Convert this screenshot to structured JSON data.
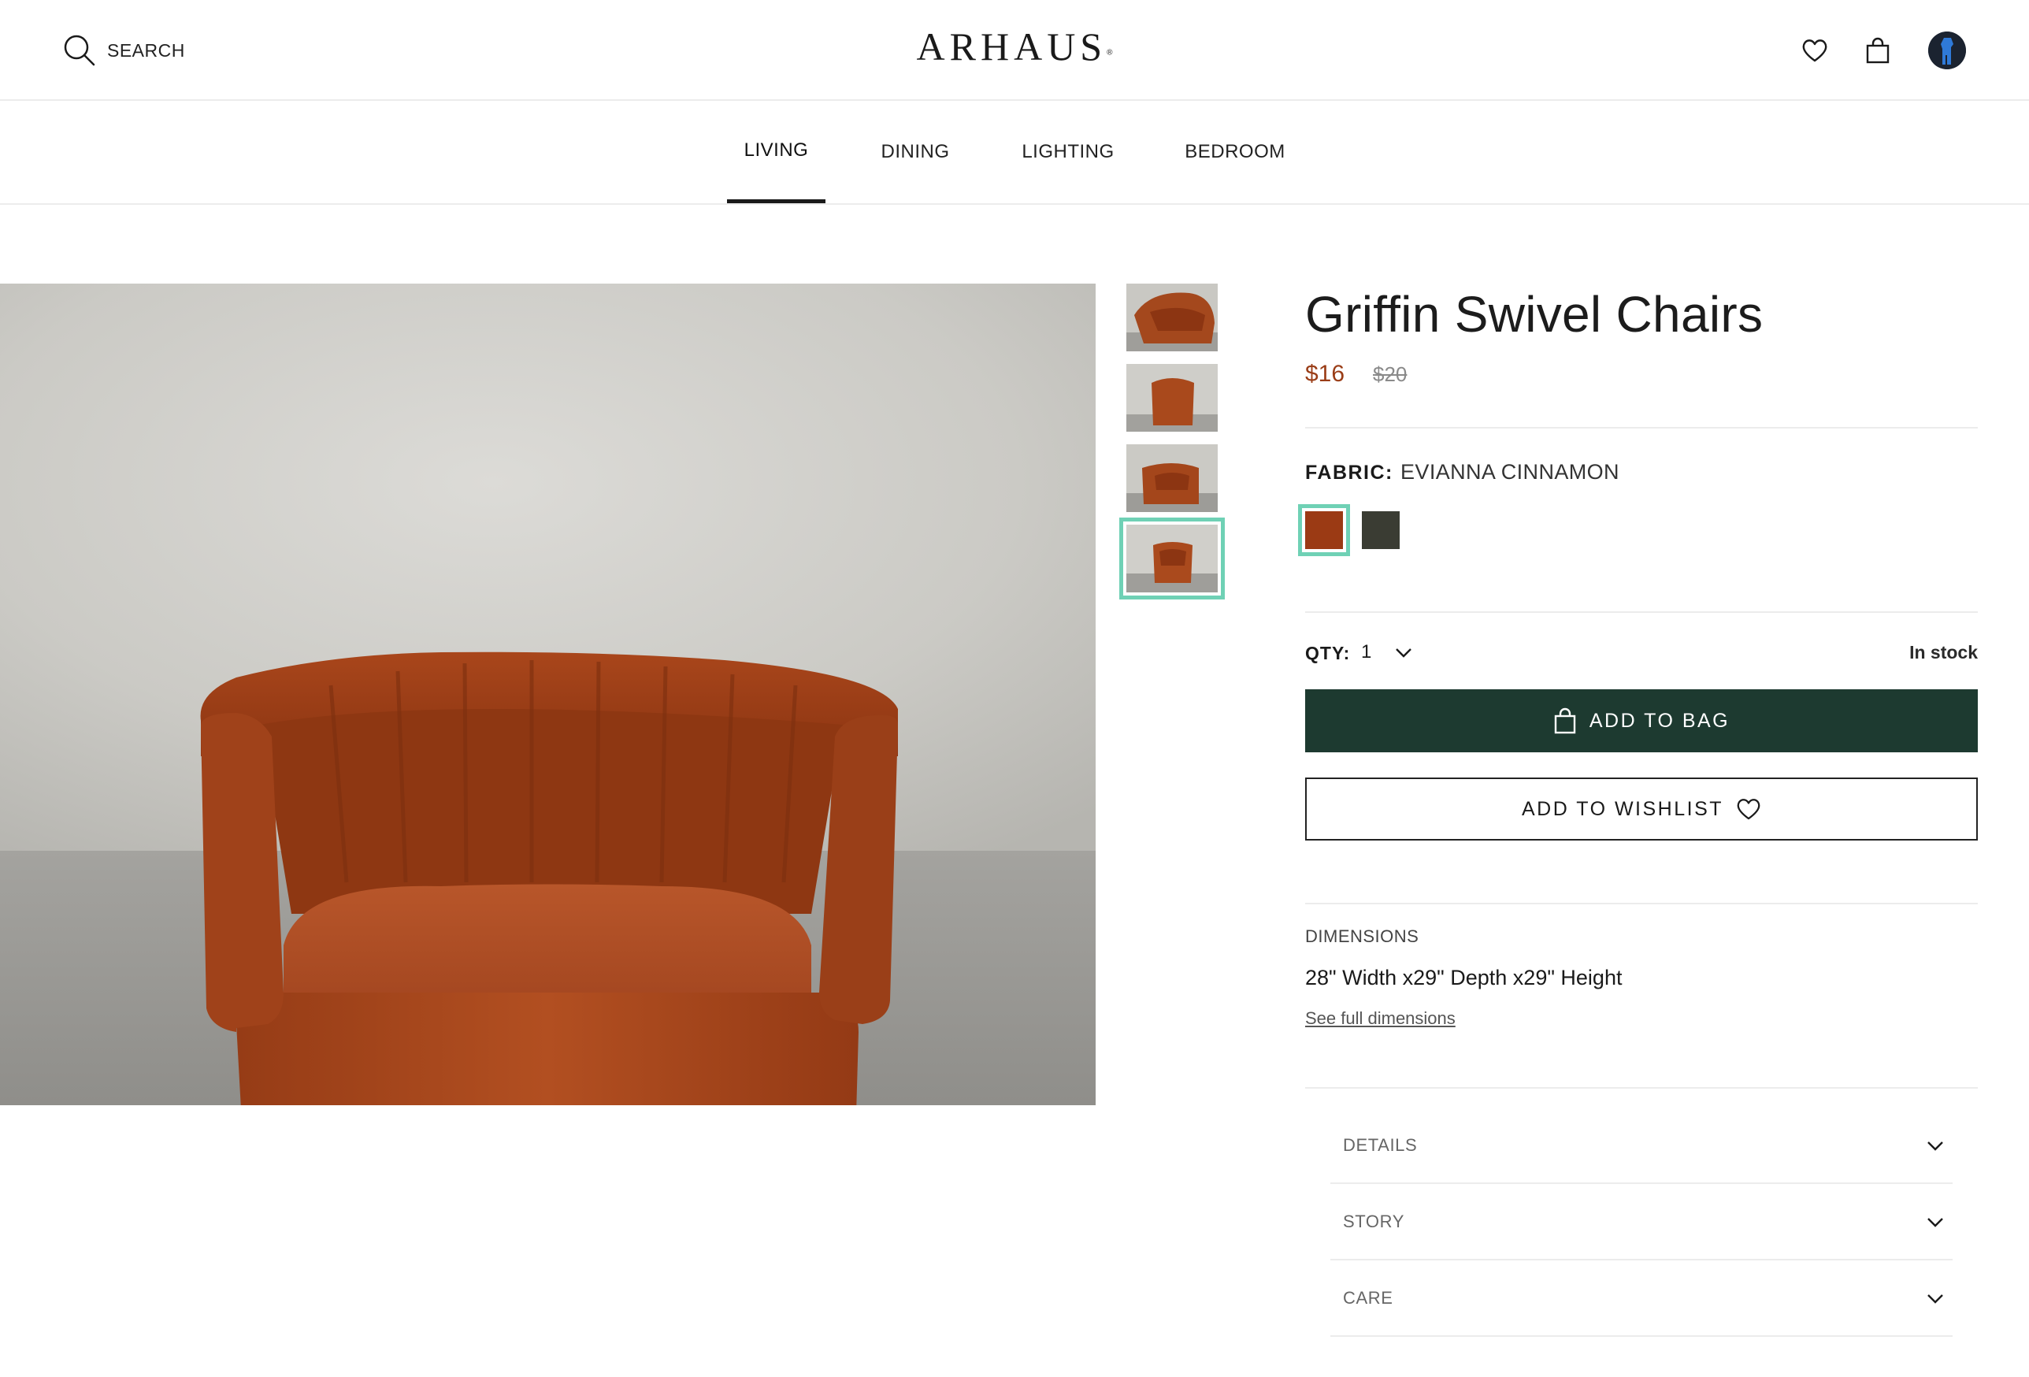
{
  "header": {
    "search_label": "SEARCH",
    "logo": "ARHAUS",
    "logo_mark": "®"
  },
  "nav": {
    "items": [
      {
        "label": "LIVING",
        "active": true
      },
      {
        "label": "DINING",
        "active": false
      },
      {
        "label": "LIGHTING",
        "active": false
      },
      {
        "label": "BEDROOM",
        "active": false
      }
    ]
  },
  "gallery": {
    "thumbnail_count": 4,
    "selected_thumbnail": 4
  },
  "product": {
    "title": "Griffin Swivel Chairs",
    "price": "$16",
    "original_price": "$20",
    "fabric_label": "FABRIC:",
    "fabric_value": "EVIANNA CINNAMON",
    "swatches": [
      {
        "name": "cinnamon",
        "color": "#9b3a14",
        "selected": true
      },
      {
        "name": "dark olive",
        "color": "#3a3c33",
        "selected": false
      }
    ],
    "qty_label": "QTY:",
    "qty_value": "1",
    "stock_status": "In stock",
    "add_to_bag_label": "ADD TO BAG",
    "add_to_wishlist_label": "ADD TO WISHLIST",
    "dimensions_label": "DIMENSIONS",
    "dimensions_value": "28\" Width x29\" Depth x29\" Height",
    "dimensions_link": "See full dimensions",
    "accordions": [
      {
        "label": "DETAILS"
      },
      {
        "label": "STORY"
      },
      {
        "label": "CARE"
      }
    ]
  },
  "colors": {
    "accent_green": "#1d3a30",
    "price_red": "#9a3d17",
    "selection_teal": "#6fd1b5",
    "upholstery": "#a84a1e"
  },
  "icons": {
    "search": "search-icon",
    "wishlist": "heart-icon",
    "bag": "shopping-bag-icon",
    "avatar": "user-avatar",
    "qty": "chevron-down-icon"
  }
}
